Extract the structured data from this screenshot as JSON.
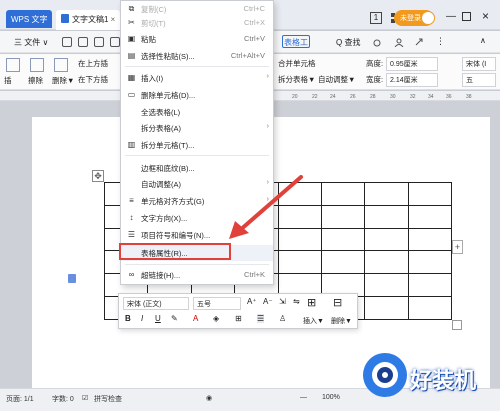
{
  "window": {
    "app_tab": "WPS 文字",
    "doc_tab": "文字文稿1",
    "login_label": "未登录",
    "badge_num": "1"
  },
  "menubar": {
    "file": "三 文件 ∨",
    "table_tools": "表格工",
    "search": "Q 查找"
  },
  "ribbon": {
    "left": [
      "在上方插",
      "在下方插"
    ],
    "left_icons": [
      "插",
      "擦除",
      "删除▼"
    ],
    "merge": "合并单元格",
    "split": "拆分表格▼",
    "auto_adjust": "自动调整▼",
    "height_label": "高度:",
    "height_value": "0.95厘米",
    "width_label": "宽度:",
    "width_value": "2.14厘米",
    "font": "宋体 (I",
    "size": "五"
  },
  "context_menu": {
    "items": [
      {
        "label": "复制(C)",
        "shortcut": "Ctrl+C",
        "icon": "copy-icon",
        "disabled": true
      },
      {
        "label": "剪切(T)",
        "shortcut": "Ctrl+X",
        "icon": "cut-icon",
        "disabled": true
      },
      {
        "label": "粘贴",
        "shortcut": "Ctrl+V",
        "icon": "paste-icon"
      },
      {
        "label": "选择性粘贴(S)...",
        "shortcut": "Ctrl+Alt+V",
        "icon": "paste-special-icon"
      },
      {
        "label": "插入(I)",
        "icon": "insert-icon",
        "submenu": true
      },
      {
        "label": "删除单元格(D)...",
        "icon": "delete-cells-icon"
      },
      {
        "label": "全选表格(L)",
        "icon": ""
      },
      {
        "label": "拆分表格(A)",
        "icon": "",
        "submenu": true
      },
      {
        "label": "拆分单元格(T)...",
        "icon": "split-cells-icon"
      },
      {
        "label": "边框和底纹(B)...",
        "icon": ""
      },
      {
        "label": "自动调整(A)",
        "icon": "",
        "submenu": true
      },
      {
        "label": "单元格对齐方式(G)",
        "icon": "cell-align-icon",
        "submenu": true
      },
      {
        "label": "文字方向(X)...",
        "icon": "text-direction-icon"
      },
      {
        "label": "项目符号和编号(N)...",
        "icon": "bullets-icon"
      },
      {
        "label": "表格属性(R)...",
        "icon": ""
      },
      {
        "label": "超链接(H)...",
        "shortcut": "Ctrl+K",
        "icon": "link-icon"
      }
    ]
  },
  "mini_toolbar": {
    "font": "宋体 (正文)",
    "size": "五号",
    "grow": "A⁺",
    "shrink": "A⁻",
    "insert": "插入▼",
    "delete": "删除▼"
  },
  "statusbar": {
    "page": "页面: 1/1",
    "words": "字数: 0",
    "spell": "拼写检查",
    "zoom": "100%"
  },
  "watermark": "好装机",
  "colors": {
    "accent": "#2e6ed6",
    "annotation": "#e0413a",
    "login": "#f29a1f"
  }
}
